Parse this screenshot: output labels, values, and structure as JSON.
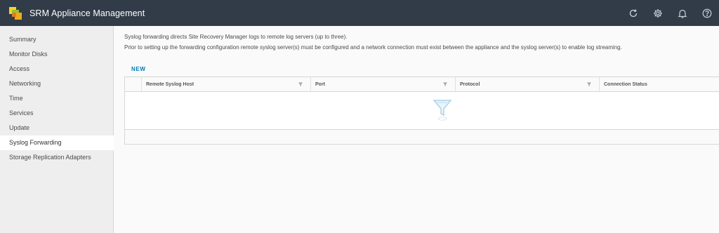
{
  "header": {
    "app_title": "SRM Appliance Management",
    "logo_icon": "srm-logo-icon",
    "icons": [
      "refresh-icon",
      "gear-icon",
      "bell-icon",
      "help-icon"
    ],
    "bg_color": "#313c48"
  },
  "sidebar": {
    "items": [
      {
        "label": "Summary",
        "active": false
      },
      {
        "label": "Monitor Disks",
        "active": false
      },
      {
        "label": "Access",
        "active": false
      },
      {
        "label": "Networking",
        "active": false
      },
      {
        "label": "Time",
        "active": false
      },
      {
        "label": "Services",
        "active": false
      },
      {
        "label": "Update",
        "active": false
      },
      {
        "label": "Syslog Forwarding",
        "active": true
      },
      {
        "label": "Storage Replication Adapters",
        "active": false
      }
    ]
  },
  "main": {
    "description_line1": "Syslog forwarding directs Site Recovery Manager logs to remote log servers (up to three).",
    "description_line2": "Prior to setting up the forwarding configuration remote syslog server(s) must be configured and a network connection must exist between the appliance and the syslog server(s) to enable log streaming.",
    "new_button_label": "NEW",
    "accent_color": "#0079b8",
    "grid": {
      "columns": [
        "Remote Syslog Host",
        "Port",
        "Protocol",
        "Connection Status"
      ],
      "rows": [],
      "empty_icon": "empty-funnel-icon"
    }
  }
}
